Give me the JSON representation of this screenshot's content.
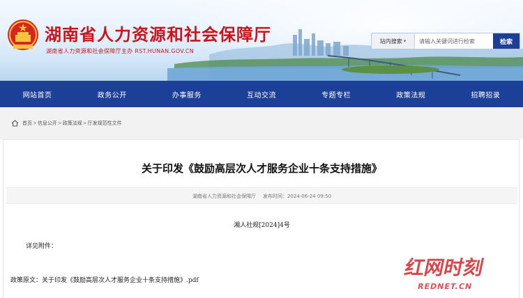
{
  "header": {
    "site_title": "湖南省人力资源和社会保障厅",
    "site_subtitle": "湖南省人力资源和社会保障厅主办  RST.HUNAN.GOV.CN",
    "search": {
      "scope": "站内搜索",
      "placeholder": "请输入关键词进行检索",
      "button": "检索"
    }
  },
  "nav": {
    "items": [
      "网站首页",
      "政务公开",
      "办事服务",
      "互动交流",
      "专题专栏",
      "政策法规",
      "招聘招录"
    ]
  },
  "breadcrumb": {
    "items": [
      "首页",
      "信息公开",
      "政策法规",
      "厅发规范性文件"
    ],
    "separator": ">"
  },
  "article": {
    "title": "关于印发《鼓励高层次人才服务企业十条支持措施》",
    "publisher": "湖南省人力资源和社会保障厅",
    "publish_label": "发布时间：",
    "publish_time": "2024-06-24 09:50",
    "doc_number": "湘人社规[2024]4号",
    "see_attachment": "详见附件：",
    "attachment_label": "政策原文：",
    "attachment_name": "关于印发《鼓励高层次人才服务企业十条支持措施》.pdf"
  },
  "watermark": {
    "brand": "红网时刻",
    "domain": "REDNET.CN"
  },
  "colors": {
    "brand_red": "#c8151d",
    "nav_blue": "#1c3f98",
    "search_button": "#1d3e95"
  }
}
